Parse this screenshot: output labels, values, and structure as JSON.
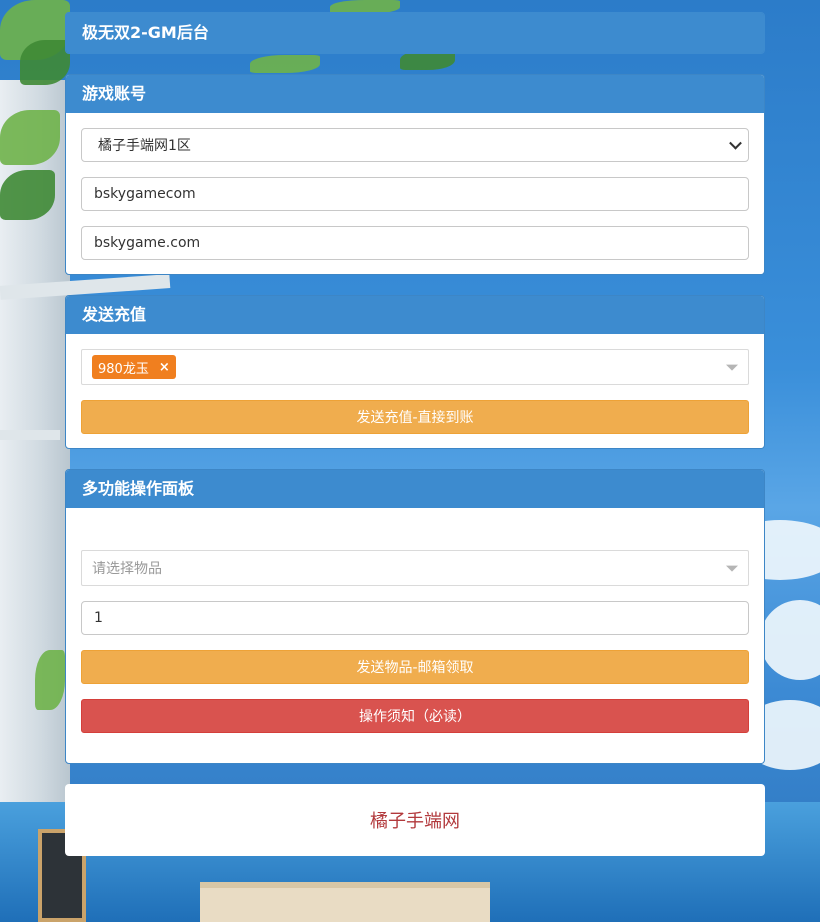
{
  "app": {
    "title": "极无双2-GM后台"
  },
  "account_panel": {
    "title": "游戏账号",
    "server_select": {
      "value": "橘子手端网1区"
    },
    "account_input": {
      "value": "bskygamecom"
    },
    "password_input": {
      "value": "bskygame.com"
    }
  },
  "recharge_panel": {
    "title": "发送充值",
    "selected_tag": {
      "label": "980龙玉",
      "remove": "×"
    },
    "send_button": "发送充值-直接到账"
  },
  "multi_panel": {
    "title": "多功能操作面板",
    "item_select": {
      "placeholder": "请选择物品"
    },
    "quantity_input": {
      "value": "1"
    },
    "send_item_button": "发送物品-邮箱领取",
    "notice_button": "操作须知（必读）"
  },
  "footer": {
    "text": "橘子手端网"
  },
  "colors": {
    "heading": "#3d8bcf",
    "warning": "#f0ad4e",
    "danger": "#d9534f",
    "tag": "#f07f1f",
    "footer_text": "#b2393c"
  }
}
